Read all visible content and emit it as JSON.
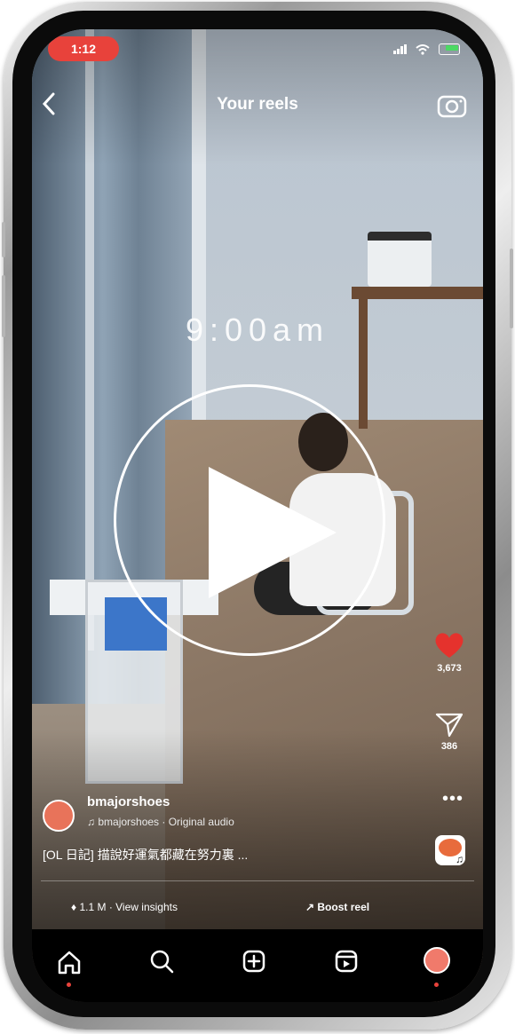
{
  "status_bar": {
    "time": "1:12",
    "signal_icon": "signal-bars-icon",
    "wifi_icon": "wifi-icon",
    "battery_icon": "battery-icon"
  },
  "header": {
    "title": "Your reels",
    "back_icon": "chevron-left-icon",
    "camera_icon": "camera-icon"
  },
  "video": {
    "overlay_text": "9:00am",
    "play_icon": "play-icon"
  },
  "actions": {
    "likes": "3,673",
    "shares": "386",
    "like_icon": "heart-icon",
    "share_icon": "paper-plane-icon",
    "more_icon": "more-icon"
  },
  "post": {
    "username": "bmajorshoes",
    "audio": "bmajorshoes · Original audio",
    "caption": "[OL 日記] 描說好運氣都藏在努力裏 ..."
  },
  "footer": {
    "insights": "1.1 M · View insights",
    "boost": "Boost reel"
  },
  "nav": {
    "items": [
      "home-icon",
      "search-icon",
      "create-icon",
      "reels-icon",
      "profile-icon"
    ]
  },
  "colors": {
    "accent_red": "#e8423b",
    "like_red": "#e5322d"
  }
}
